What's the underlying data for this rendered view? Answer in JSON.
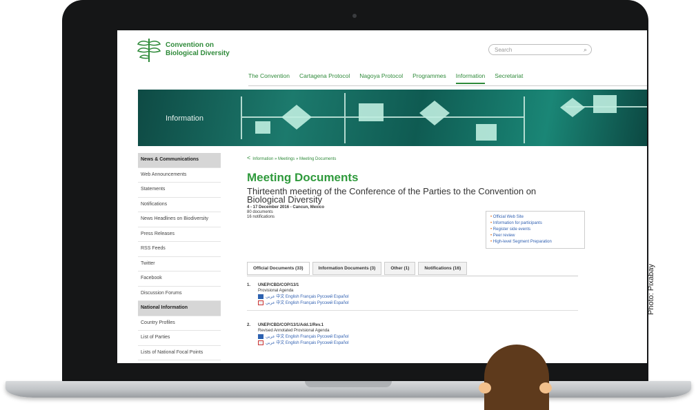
{
  "photo_credit": "Photo: Pixabay",
  "site": {
    "logo_text_line1": "Convention on",
    "logo_text_line2": "Biological Diversity",
    "search_placeholder": "Search",
    "nav": [
      {
        "label": "The Convention",
        "active": false
      },
      {
        "label": "Cartagena Protocol",
        "active": false
      },
      {
        "label": "Nagoya Protocol",
        "active": false
      },
      {
        "label": "Programmes",
        "active": false
      },
      {
        "label": "Information",
        "active": true
      },
      {
        "label": "Secretariat",
        "active": false
      }
    ],
    "banner_label": "Information",
    "colors": {
      "brand_green": "#2f8a3a",
      "banner_teal": "#1c7a6d",
      "link_blue": "#2f5fb0"
    }
  },
  "sidebar": {
    "items": [
      {
        "label": "News & Communications",
        "heading": true
      },
      {
        "label": "Web Announcements",
        "heading": false
      },
      {
        "label": "Statements",
        "heading": false
      },
      {
        "label": "Notifications",
        "heading": false
      },
      {
        "label": "News Headlines on Biodiversity",
        "heading": false
      },
      {
        "label": "Press Releases",
        "heading": false
      },
      {
        "label": "RSS Feeds",
        "heading": false
      },
      {
        "label": "Twitter",
        "heading": false
      },
      {
        "label": "Facebook",
        "heading": false
      },
      {
        "label": "Discussion Forums",
        "heading": false
      },
      {
        "label": "National Information",
        "heading": true
      },
      {
        "label": "Country Profiles",
        "heading": false
      },
      {
        "label": "List of Parties",
        "heading": false
      },
      {
        "label": "Lists of National Focal Points",
        "heading": false
      }
    ]
  },
  "main": {
    "breadcrumb": "Information » Meetings » Meeting Documents",
    "title": "Meeting Documents",
    "subtitle": "Thirteenth meeting of the Conference of the Parties to the Convention on Biological Diversity",
    "dates": "4 - 17 December 2016 - Cancun, Mexico",
    "documents_count": "80 documents",
    "notifications_count": "16 notifications",
    "links": [
      "Official Web Site",
      "Information for participants",
      "Register side events",
      "Peer review",
      "High-level Segment Preparation"
    ],
    "tabs": [
      {
        "label": "Official Documents (33)",
        "active": true
      },
      {
        "label": "Information Documents (3)",
        "active": false
      },
      {
        "label": "Other (1)",
        "active": false
      },
      {
        "label": "Notifications (16)",
        "active": false
      }
    ],
    "documents": [
      {
        "number": "1.",
        "symbol": "UNEP/CBD/COP/13/1",
        "title": "Provisional Agenda",
        "word_langs": "عربي 中文 English Français Русский Español",
        "pdf_langs": "عربي 中文 English Français Русский Español"
      },
      {
        "number": "2.",
        "symbol": "UNEP/CBD/COP/13/1/Add.1/Rev.1",
        "title": "Revised Annotated Provisional Agenda",
        "word_langs": "عربي 中文 English Français Русский Español",
        "pdf_langs": "عربي 中文 English Français Русский Español"
      }
    ]
  }
}
